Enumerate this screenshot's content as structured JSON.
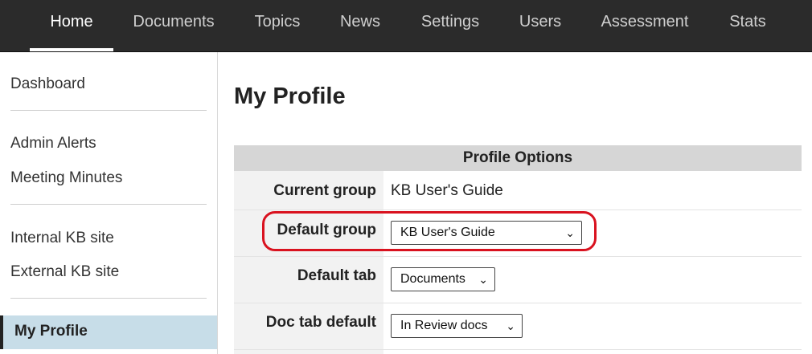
{
  "nav": {
    "tabs": [
      {
        "label": "Home"
      },
      {
        "label": "Documents"
      },
      {
        "label": "Topics"
      },
      {
        "label": "News"
      },
      {
        "label": "Settings"
      },
      {
        "label": "Users"
      },
      {
        "label": "Assessment"
      },
      {
        "label": "Stats"
      }
    ],
    "active_tab": "Home"
  },
  "sidebar": {
    "items": [
      {
        "label": "Dashboard"
      },
      {
        "label": "Admin Alerts"
      },
      {
        "label": "Meeting Minutes"
      },
      {
        "label": "Internal KB site"
      },
      {
        "label": "External KB site"
      },
      {
        "label": "My Profile"
      }
    ],
    "active_item": "My Profile"
  },
  "main": {
    "title": "My Profile",
    "table": {
      "header": "Profile Options",
      "rows": [
        {
          "label": "Current group",
          "value": "KB User's Guide"
        },
        {
          "label": "Default group",
          "value": "KB User's Guide"
        },
        {
          "label": "Default tab",
          "value": "Documents"
        },
        {
          "label": "Doc tab default",
          "value": "In Review docs"
        }
      ]
    }
  },
  "icons": {
    "dropdown": "chevron-down-icon"
  },
  "colors": {
    "nav_bg": "#2b2b2b",
    "sidebar_active": "#c7dde8",
    "table_header": "#d6d6d6",
    "highlight": "#d9121f"
  }
}
